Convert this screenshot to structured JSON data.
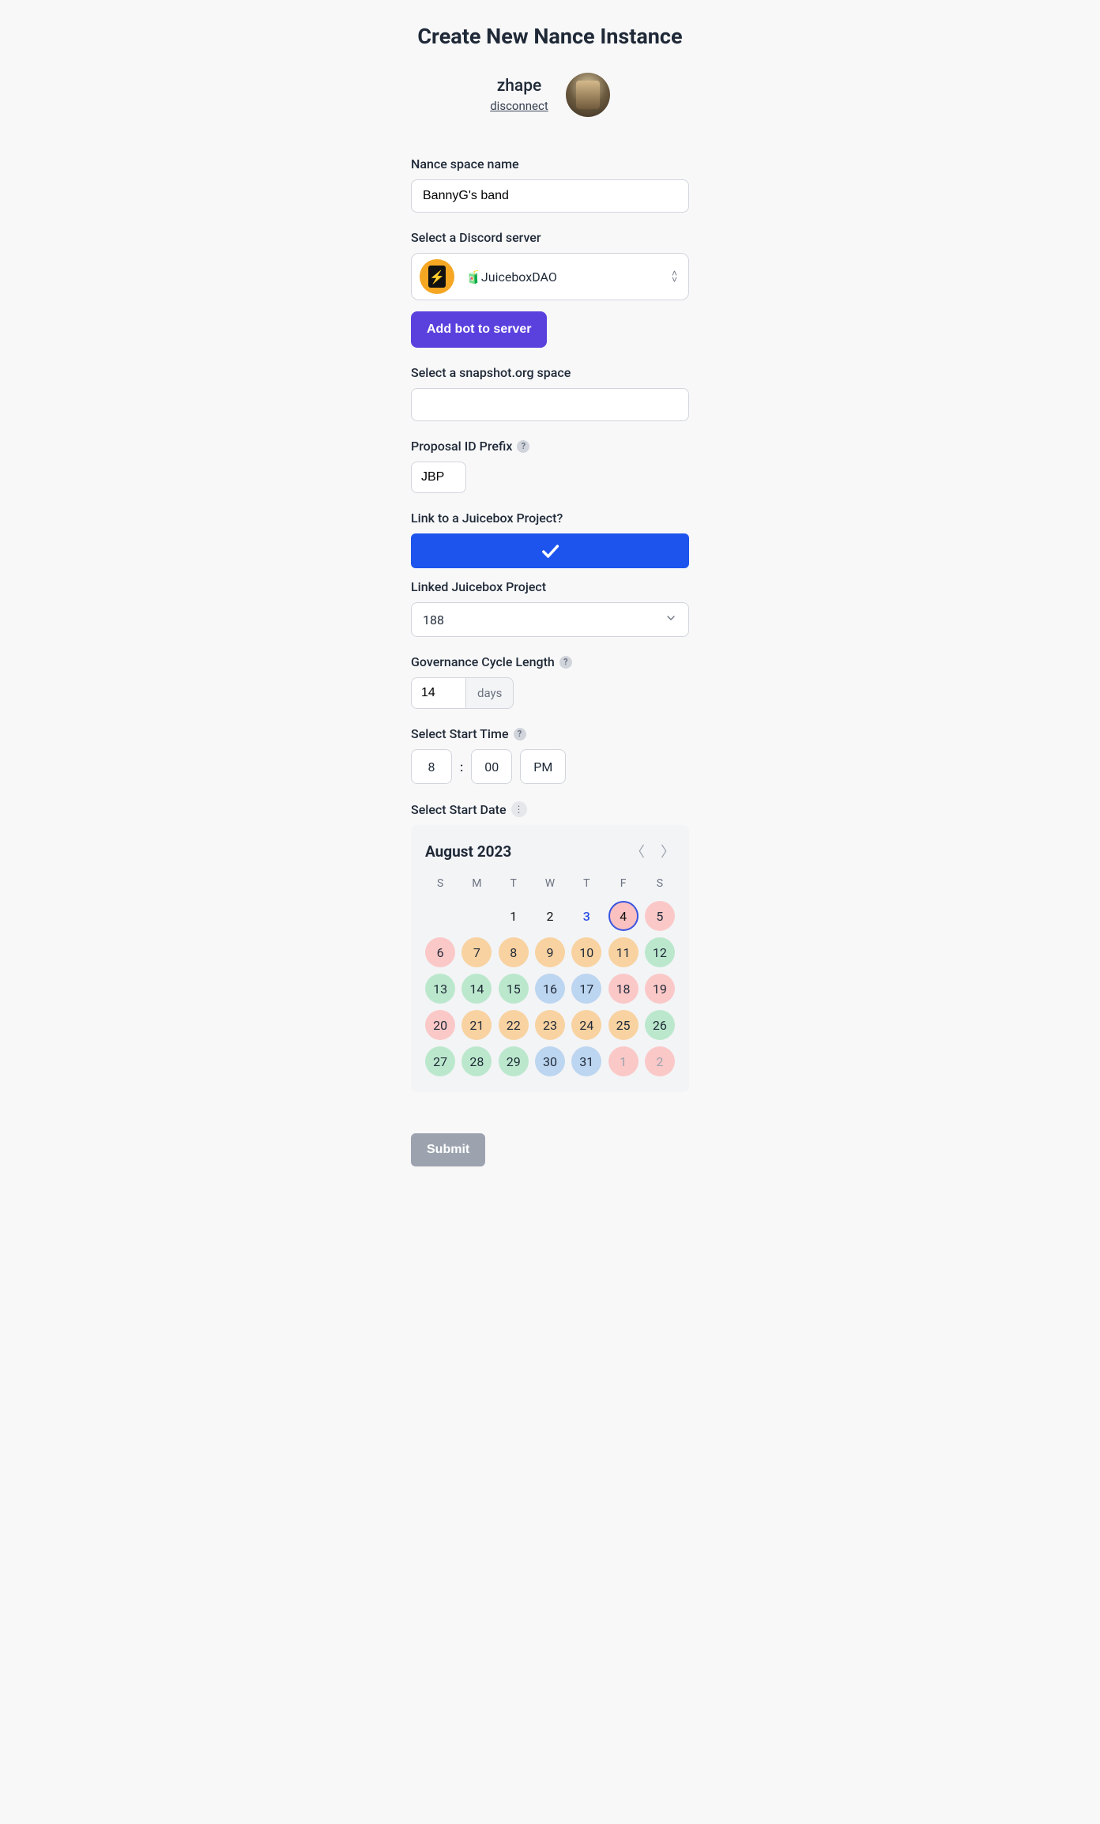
{
  "header": {
    "title": "Create New Nance Instance",
    "username": "zhape",
    "disconnect": "disconnect"
  },
  "form": {
    "name_label": "Nance space name",
    "name_value": "BannyG's band",
    "discord_label": "Select a Discord server",
    "discord_emoji": "🧃",
    "discord_value": "JuiceboxDAO",
    "add_bot": "Add bot to server",
    "snapshot_label": "Select a snapshot.org space",
    "snapshot_value": "",
    "prefix_label": "Proposal ID Prefix",
    "prefix_value": "JBP",
    "link_label": "Link to a Juicebox Project?",
    "linked_label": "Linked Juicebox Project",
    "linked_value": "188",
    "cycle_label": "Governance Cycle Length",
    "cycle_value": "14",
    "cycle_unit": "days",
    "start_time_label": "Select Start Time",
    "hour": "8",
    "minute": "00",
    "ampm": "PM",
    "start_date_label": "Select Start Date",
    "submit": "Submit"
  },
  "calendar": {
    "title": "August 2023",
    "dows": [
      "S",
      "M",
      "T",
      "W",
      "T",
      "F",
      "S"
    ],
    "cells": [
      {
        "n": "",
        "cls": "empty"
      },
      {
        "n": "",
        "cls": "empty"
      },
      {
        "n": "1",
        "cls": "plain"
      },
      {
        "n": "2",
        "cls": "plain"
      },
      {
        "n": "3",
        "cls": "link"
      },
      {
        "n": "4",
        "cls": "sel"
      },
      {
        "n": "5",
        "cls": "pink"
      },
      {
        "n": "6",
        "cls": "pink"
      },
      {
        "n": "7",
        "cls": "orange"
      },
      {
        "n": "8",
        "cls": "orange"
      },
      {
        "n": "9",
        "cls": "orange"
      },
      {
        "n": "10",
        "cls": "orange"
      },
      {
        "n": "11",
        "cls": "orange"
      },
      {
        "n": "12",
        "cls": "green"
      },
      {
        "n": "13",
        "cls": "green"
      },
      {
        "n": "14",
        "cls": "green"
      },
      {
        "n": "15",
        "cls": "green"
      },
      {
        "n": "16",
        "cls": "blue"
      },
      {
        "n": "17",
        "cls": "blue"
      },
      {
        "n": "18",
        "cls": "pink"
      },
      {
        "n": "19",
        "cls": "pink"
      },
      {
        "n": "20",
        "cls": "pink"
      },
      {
        "n": "21",
        "cls": "orange"
      },
      {
        "n": "22",
        "cls": "orange"
      },
      {
        "n": "23",
        "cls": "orange"
      },
      {
        "n": "24",
        "cls": "orange"
      },
      {
        "n": "25",
        "cls": "orange"
      },
      {
        "n": "26",
        "cls": "green"
      },
      {
        "n": "27",
        "cls": "green"
      },
      {
        "n": "28",
        "cls": "green"
      },
      {
        "n": "29",
        "cls": "green"
      },
      {
        "n": "30",
        "cls": "blue"
      },
      {
        "n": "31",
        "cls": "blue"
      },
      {
        "n": "1",
        "cls": "pink dim"
      },
      {
        "n": "2",
        "cls": "pink dim"
      }
    ]
  }
}
